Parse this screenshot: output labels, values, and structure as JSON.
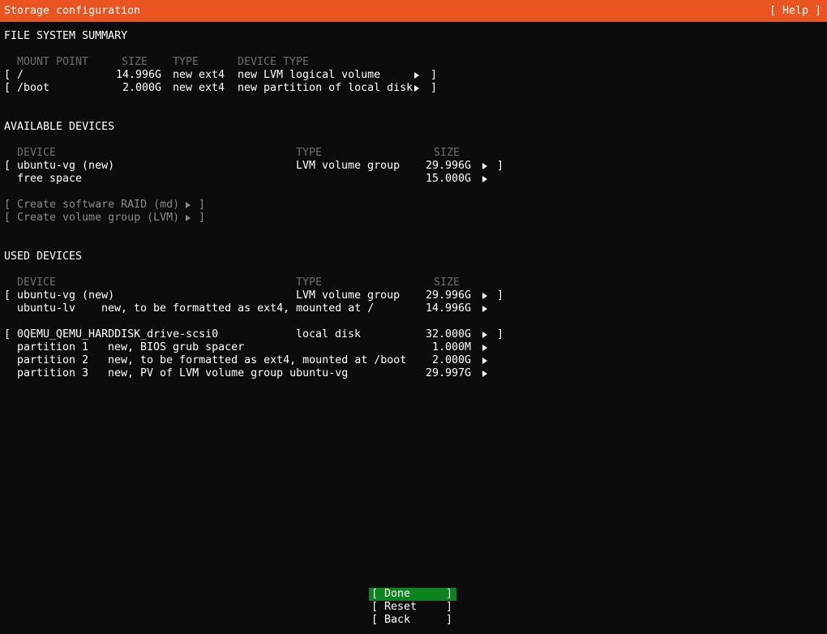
{
  "glyphs": {
    "lbracket": "[",
    "rbracket": "]"
  },
  "colors": {
    "header_bg": "#e95420",
    "background": "#0c0c0c",
    "text": "#ffffff",
    "dim_header": "#6e6e6e",
    "dim_action": "#8a8a8a",
    "focus_green": "#0e8420"
  },
  "header": {
    "title": "Storage configuration",
    "help": "[ Help ]"
  },
  "fs": {
    "title": "FILE SYSTEM SUMMARY",
    "headers": {
      "mount": "MOUNT POINT",
      "size": "SIZE",
      "type": "TYPE",
      "device_type": "DEVICE TYPE"
    },
    "rows": [
      {
        "mount": "/",
        "size": "14.996G",
        "type": "new ext4",
        "device_type": "new LVM logical volume"
      },
      {
        "mount": "/boot",
        "size": "2.000G",
        "type": "new ext4",
        "device_type": "new partition of local disk"
      }
    ]
  },
  "available": {
    "title": "AVAILABLE DEVICES",
    "headers": {
      "device": "DEVICE",
      "type": "TYPE",
      "size": "SIZE"
    },
    "rows": [
      {
        "device": "ubuntu-vg (new)",
        "type": "LVM volume group",
        "size": "29.996G"
      },
      {
        "device": "free space",
        "type": "",
        "size": "15.000G"
      }
    ],
    "actions": [
      {
        "label": "Create software RAID (md)"
      },
      {
        "label": "Create volume group (LVM)"
      }
    ]
  },
  "used": {
    "title": "USED DEVICES",
    "headers": {
      "device": "DEVICE",
      "type": "TYPE",
      "size": "SIZE"
    },
    "vg": {
      "device": "ubuntu-vg (new)",
      "type": "LVM volume group",
      "size": "29.996G"
    },
    "lv": {
      "device": "ubuntu-lv",
      "note": "new, to be formatted as ext4, mounted at /",
      "size": "14.996G"
    },
    "disk": {
      "device": "0QEMU_QEMU_HARDDISK_drive-scsi0",
      "type": "local disk",
      "size": "32.000G"
    },
    "partitions": [
      {
        "device": "partition 1",
        "note": "new, BIOS grub spacer",
        "size": "1.000M"
      },
      {
        "device": "partition 2",
        "note": "new, to be formatted as ext4, mounted at /boot",
        "size": "2.000G"
      },
      {
        "device": "partition 3",
        "note": "new, PV of LVM volume group ubuntu-vg",
        "size": "29.997G"
      }
    ]
  },
  "buttons": [
    {
      "label": "Done"
    },
    {
      "label": "Reset"
    },
    {
      "label": "Back"
    }
  ]
}
